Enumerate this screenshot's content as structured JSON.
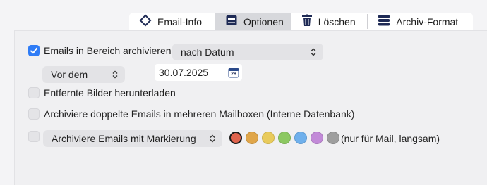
{
  "tabs": [
    {
      "label": "Email-Info",
      "icon": "diamond-icon"
    },
    {
      "label": "Optionen",
      "icon": "window-icon",
      "active": true
    },
    {
      "label": "Löschen",
      "icon": "trash-icon"
    },
    {
      "label": "Archiv-Format",
      "icon": "database-icon"
    }
  ],
  "archive_range": {
    "label": "Emails in Bereich archivieren:",
    "checked": true,
    "select_value": "nach Datum"
  },
  "date_filter": {
    "mode": "Vor dem",
    "date": "30.07.2025",
    "calendar_day": "28"
  },
  "options": {
    "remove_images": {
      "label": "Entfernte Bilder herunterladen",
      "checked": false
    },
    "duplicates": {
      "label": "Archiviere doppelte Emails in mehreren Mailboxen (Interne Datenbank)",
      "checked": false
    }
  },
  "flag_archive": {
    "checked": false,
    "select_value": "Archiviere Emails mit Markierung",
    "colors": [
      "#e0644e",
      "#e0a64a",
      "#e9cb5c",
      "#8cc862",
      "#6fb0ec",
      "#c28ad8",
      "#9e9e9e"
    ],
    "selected_color_index": 0,
    "note": "(nur für Mail, langsam)"
  },
  "accent": "#2f7cf6"
}
